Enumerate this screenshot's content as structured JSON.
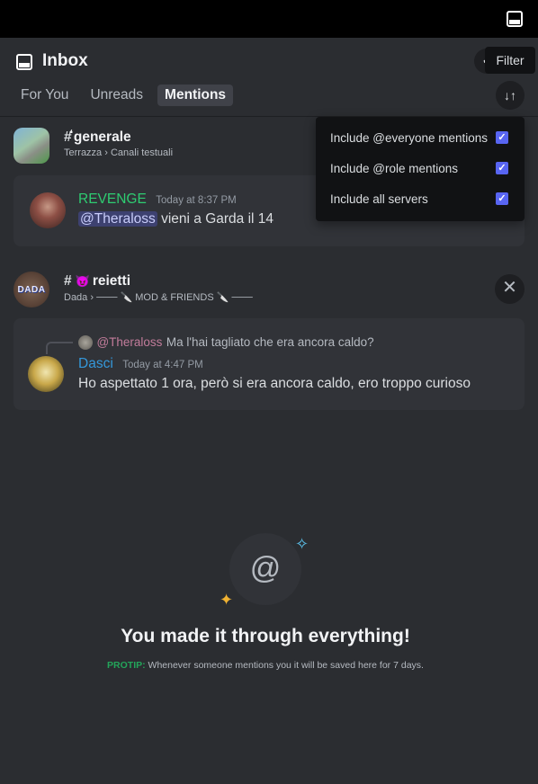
{
  "header": {
    "title": "Inbox",
    "filter_tooltip": "Filter",
    "partial_button_glyph": "✔",
    "filter_glyph": "↓↑"
  },
  "tabs": [
    {
      "label": "For You",
      "active": false
    },
    {
      "label": "Unreads",
      "active": false
    },
    {
      "label": "Mentions",
      "active": true
    }
  ],
  "filter_menu": {
    "items": [
      {
        "label": "Include @everyone mentions",
        "checked": true
      },
      {
        "label": "Include @role mentions",
        "checked": true
      },
      {
        "label": "Include all servers",
        "checked": true
      }
    ]
  },
  "channels": [
    {
      "hash": "#",
      "name": "generale",
      "name_prefix_glyph": "❛",
      "subtitle": "Terrazza › Canali testuali",
      "messages": [
        {
          "author": "REVENGE",
          "time": "Today at 8:37 PM",
          "mention": "@Theraloss",
          "text": " vieni a Garda il 14"
        }
      ]
    },
    {
      "hash": "#",
      "emoji": "😈",
      "name": "reietti",
      "avatar_text": "DADA",
      "subtitle": "Dada › ─── 🔪 MOD & FRIENDS 🔪 ───",
      "close_glyph": "✕",
      "messages": [
        {
          "reply_author": "@Theraloss",
          "reply_text": "Ma l'hai tagliato che era ancora caldo?",
          "author": "Dasci",
          "time": "Today at 4:47 PM",
          "text": "Ho aspettato 1 ora, però si era ancora caldo, ero troppo curioso"
        }
      ]
    }
  ],
  "empty_state": {
    "icon": "@",
    "title": "You made it through everything!",
    "protip_label": "PROTIP:",
    "protip_text": " Whenever someone mentions you it will be saved here for 7 days."
  },
  "colors": {
    "background": "#2b2d31",
    "card": "#313338",
    "accent": "#5865f2",
    "revenge": "#2ecc71",
    "dasci": "#3498db",
    "protip": "#23a55a"
  }
}
